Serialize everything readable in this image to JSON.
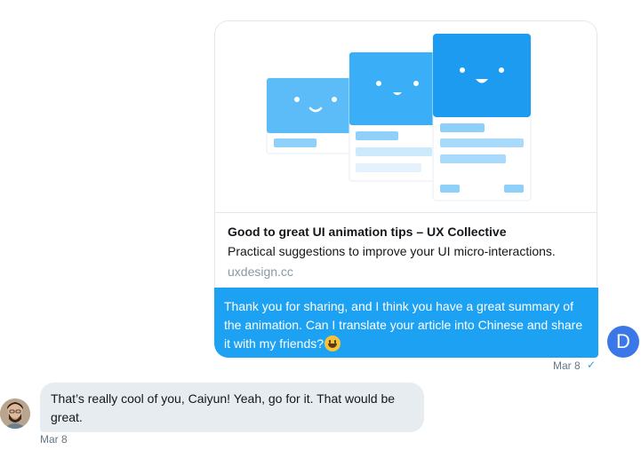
{
  "link_card": {
    "title": "Good to great UI animation tips – UX Collective",
    "description": "Practical suggestions to improve your UI micro-interactions.",
    "domain": "uxdesign.cc"
  },
  "outgoing": {
    "text": "Thank you for sharing, and I think you have a great summary of the animation. Can I translate your article into Chinese and share it with my friends?",
    "emoji": "grinning-face",
    "timestamp": "Mar 8",
    "status_icon": "check-icon",
    "avatar_initial": "D"
  },
  "incoming": {
    "text": "That’s really cool of you, Caiyun! Yeah, go for it. That would be great.",
    "timestamp": "Mar 8"
  },
  "colors": {
    "accent": "#1da1f2",
    "incoming_bubble": "#e6ecf0",
    "avatar_d": "#3b78e7",
    "illustration_blue": "#1c9bf0"
  }
}
